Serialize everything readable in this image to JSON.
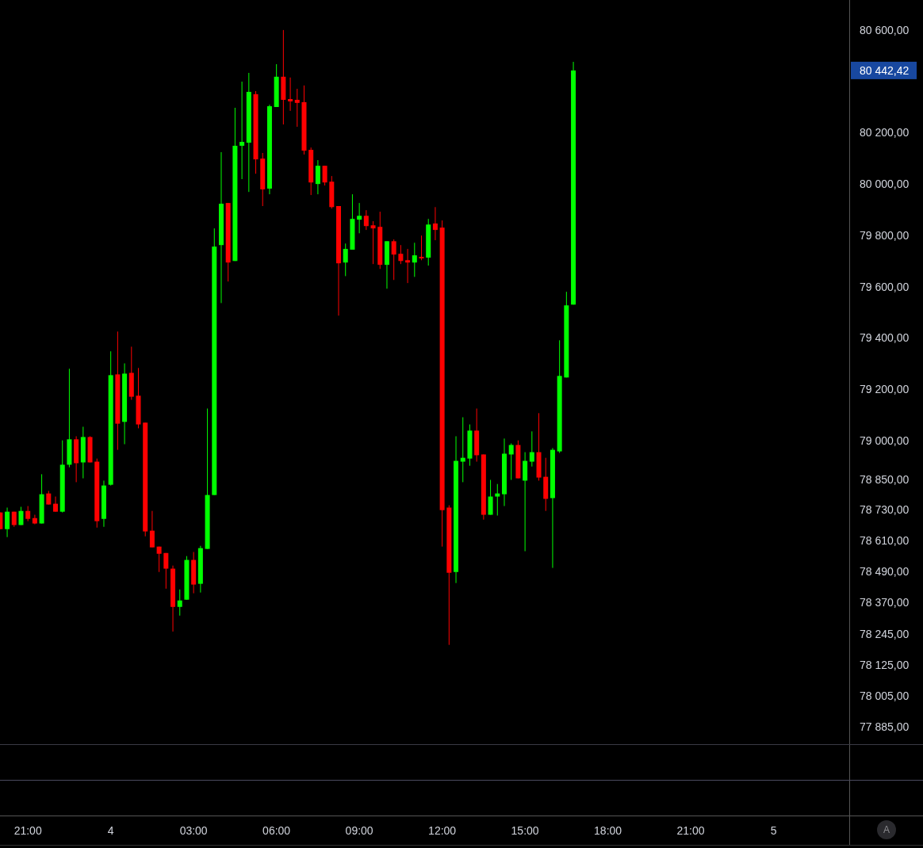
{
  "chart": {
    "chart_data": {
      "type": "candlestick",
      "ylim": [
        77817,
        80717
      ],
      "categories": [
        null,
        null,
        null,
        null,
        "21:00",
        null,
        null,
        null,
        null,
        null,
        null,
        null,
        null,
        null,
        null,
        null,
        "4",
        null,
        null,
        null,
        null,
        null,
        null,
        null,
        null,
        null,
        null,
        null,
        "03:00",
        null,
        null,
        null,
        null,
        null,
        null,
        null,
        null,
        null,
        null,
        null,
        "06:00",
        null,
        null,
        null,
        null,
        null,
        null,
        null,
        null,
        null,
        null,
        null,
        "09:00",
        null,
        null,
        null,
        null,
        null,
        null,
        null,
        null,
        null,
        null,
        null,
        "12:00",
        null,
        null,
        null,
        null,
        null,
        null,
        null,
        null,
        null,
        null,
        null,
        "15:00",
        null,
        null,
        null,
        null,
        null,
        null,
        null,
        null,
        null,
        null,
        null,
        "18:00",
        null,
        null,
        null,
        null,
        null,
        null,
        null,
        null,
        null,
        null,
        null,
        "21:00",
        null,
        null,
        null,
        null,
        null,
        null,
        null,
        null,
        null,
        null,
        null,
        "5",
        null,
        null,
        null,
        null,
        null,
        null,
        null,
        null,
        null,
        null
      ],
      "yticks": [
        {
          "value": 80600,
          "label": "80 600,00"
        },
        {
          "value": 80200,
          "label": "80 200,00"
        },
        {
          "value": 80000,
          "label": "80 000,00"
        },
        {
          "value": 79800,
          "label": "79 800,00"
        },
        {
          "value": 79600,
          "label": "79 600,00"
        },
        {
          "value": 79400,
          "label": "79 400,00"
        },
        {
          "value": 79200,
          "label": "79 200,00"
        },
        {
          "value": 79000,
          "label": "79 000,00"
        },
        {
          "value": 78850,
          "label": "78 850,00"
        },
        {
          "value": 78730,
          "label": "78 730,00"
        },
        {
          "value": 78610,
          "label": "78 610,00"
        },
        {
          "value": 78490,
          "label": "78 490,00"
        },
        {
          "value": 78370,
          "label": "78 370,00"
        },
        {
          "value": 78245,
          "label": "78 245,00"
        },
        {
          "value": 78125,
          "label": "78 125,00"
        },
        {
          "value": 78005,
          "label": "78 005,00"
        },
        {
          "value": 77885,
          "label": "77 885,00"
        }
      ],
      "ohlc": [
        [
          78720,
          78720,
          78655,
          78655
        ],
        [
          78655,
          78739,
          78624,
          78723
        ],
        [
          78723,
          78723,
          78664,
          78671
        ],
        [
          78671,
          78742,
          78671,
          78726
        ],
        [
          78726,
          78745,
          78686,
          78695
        ],
        [
          78698,
          78711,
          78674,
          78677
        ],
        [
          78677,
          78869,
          78677,
          78791
        ],
        [
          78794,
          78804,
          78751,
          78751
        ],
        [
          78754,
          78782,
          78723,
          78723
        ],
        [
          78723,
          79001,
          78720,
          78906
        ],
        [
          78906,
          79280,
          78896,
          79005
        ],
        [
          79005,
          79017,
          78838,
          78912
        ],
        [
          78915,
          79054,
          78853,
          79014
        ],
        [
          79014,
          79017,
          78915,
          78915
        ],
        [
          78918,
          78930,
          78661,
          78686
        ],
        [
          78695,
          78844,
          78664,
          78825
        ],
        [
          78828,
          79348,
          78825,
          79255
        ],
        [
          79258,
          79425,
          78964,
          79066
        ],
        [
          79073,
          79301,
          78986,
          79261
        ],
        [
          79264,
          79366,
          79159,
          79171
        ],
        [
          79175,
          79283,
          79048,
          79063
        ],
        [
          79070,
          79070,
          78627,
          78646
        ],
        [
          78649,
          78726,
          78584,
          78584
        ],
        [
          78587,
          78587,
          78488,
          78559
        ],
        [
          78562,
          78562,
          78423,
          78501
        ],
        [
          78501,
          78513,
          78256,
          78352
        ],
        [
          78352,
          78420,
          78318,
          78377
        ],
        [
          78380,
          78550,
          78380,
          78535
        ],
        [
          78535,
          78566,
          78405,
          78439
        ],
        [
          78442,
          78590,
          78408,
          78581
        ],
        [
          78578,
          79125,
          78578,
          78788
        ],
        [
          78788,
          79827,
          78788,
          79756
        ],
        [
          79762,
          80124,
          79536,
          79923
        ],
        [
          79926,
          79926,
          79620,
          79694
        ],
        [
          79700,
          80297,
          79700,
          80149
        ],
        [
          80149,
          80399,
          80019,
          80164
        ],
        [
          80161,
          80433,
          79969,
          80359
        ],
        [
          80350,
          80362,
          80040,
          80096
        ],
        [
          80099,
          80121,
          79914,
          79979
        ],
        [
          79982,
          80309,
          79960,
          80303
        ],
        [
          80300,
          80467,
          80300,
          80418
        ],
        [
          80418,
          80600,
          80232,
          80328
        ],
        [
          80331,
          80415,
          80285,
          80322
        ],
        [
          80328,
          80371,
          80223,
          80316
        ],
        [
          80319,
          80384,
          80115,
          80130
        ],
        [
          80133,
          80142,
          79957,
          80006
        ],
        [
          80000,
          80093,
          79960,
          80071
        ],
        [
          80071,
          80071,
          79994,
          80006
        ],
        [
          80009,
          80031,
          79904,
          79910
        ],
        [
          79914,
          79914,
          79487,
          79691
        ],
        [
          79694,
          79768,
          79641,
          79747
        ],
        [
          79744,
          79960,
          79744,
          79864
        ],
        [
          79861,
          79926,
          79808,
          79876
        ],
        [
          79876,
          79898,
          79821,
          79836
        ],
        [
          79839,
          79855,
          79688,
          79827
        ],
        [
          79833,
          79892,
          79669,
          79685
        ],
        [
          79685,
          79777,
          79592,
          79777
        ],
        [
          79777,
          79784,
          79626,
          79725
        ],
        [
          79728,
          79762,
          79688,
          79700
        ],
        [
          79703,
          79747,
          79614,
          79694
        ],
        [
          79694,
          79771,
          79638,
          79722
        ],
        [
          79716,
          79799,
          79703,
          79710
        ],
        [
          79713,
          79864,
          79682,
          79842
        ],
        [
          79846,
          79910,
          79781,
          79821
        ],
        [
          79830,
          79858,
          78587,
          78729
        ],
        [
          78739,
          78748,
          78204,
          78485
        ],
        [
          78488,
          79017,
          78445,
          78921
        ],
        [
          78918,
          79091,
          78838,
          78933
        ],
        [
          78930,
          79063,
          78902,
          79039
        ],
        [
          79039,
          79125,
          78918,
          78943
        ],
        [
          78946,
          78946,
          78692,
          78711
        ],
        [
          78711,
          78847,
          78711,
          78782
        ],
        [
          78782,
          78831,
          78708,
          78794
        ],
        [
          78791,
          79008,
          78745,
          78949
        ],
        [
          78946,
          78989,
          78847,
          78983
        ],
        [
          78983,
          79001,
          78853,
          78853
        ],
        [
          78844,
          78955,
          78569,
          78921
        ],
        [
          78918,
          79036,
          78899,
          78955
        ],
        [
          78955,
          79107,
          78844,
          78856
        ],
        [
          78859,
          78933,
          78726,
          78773
        ],
        [
          78776,
          78971,
          78504,
          78964
        ],
        [
          78958,
          79391,
          78952,
          79252
        ],
        [
          79246,
          79580,
          79246,
          79527
        ],
        [
          79530,
          80476,
          79530,
          80442.42
        ],
        null,
        null,
        null,
        null,
        null,
        null,
        null,
        null,
        null,
        null,
        null,
        null,
        null,
        null,
        null,
        null,
        null,
        null,
        null,
        null,
        null,
        null,
        null,
        null,
        null,
        null,
        null,
        null,
        null,
        null,
        null,
        null,
        null,
        null,
        null,
        null,
        null,
        null,
        null
      ]
    }
  },
  "current_price": {
    "label": "80 442,42"
  },
  "autoscale_button": {
    "label": "A"
  }
}
